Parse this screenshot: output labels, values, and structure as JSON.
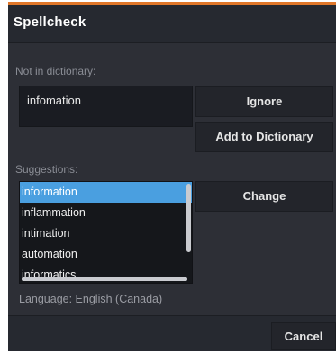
{
  "dialog": {
    "title": "Spellcheck",
    "accent_color": "#e0772a"
  },
  "not_in_dictionary": {
    "label": "Not in dictionary:",
    "word": "infomation"
  },
  "buttons": {
    "ignore": "Ignore",
    "add_to_dictionary": "Add to Dictionary",
    "change": "Change",
    "cancel": "Cancel"
  },
  "suggestions": {
    "label": "Suggestions:",
    "items": [
      "information",
      "inflammation",
      "intimation",
      "automation",
      "informatics"
    ],
    "selected_index": 0,
    "selected_color": "#4a9fe0"
  },
  "language": {
    "label": "Language: English (Canada)"
  }
}
